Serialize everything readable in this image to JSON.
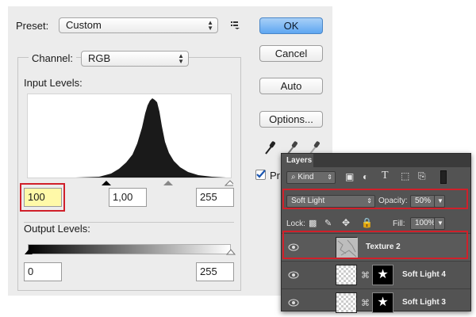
{
  "dialog": {
    "preset_label": "Preset:",
    "preset_value": "Custom",
    "channel_label": "Channel:",
    "channel_value": "RGB",
    "input_levels_label": "Input Levels:",
    "input_black": "100",
    "input_gamma": "1,00",
    "input_white": "255",
    "output_levels_label": "Output Levels:",
    "output_black": "0",
    "output_white": "255",
    "buttons": {
      "ok": "OK",
      "cancel": "Cancel",
      "auto": "Auto",
      "options": "Options..."
    },
    "preview_label": "Pr"
  },
  "layers_panel": {
    "tab": "Layers",
    "kind_label": "Kind",
    "blend_mode": "Soft Light",
    "opacity_label": "Opacity:",
    "opacity_value": "50%",
    "lock_label": "Lock:",
    "fill_label": "Fill:",
    "fill_value": "100%",
    "layers": [
      {
        "name": "Texture 2"
      },
      {
        "name": "Soft Light 4"
      },
      {
        "name": "Soft Light 3"
      }
    ]
  },
  "colors": {
    "highlight": "#d0202a",
    "ok_button": "#5ea6f1",
    "input_black_field": "#fff9a8"
  }
}
